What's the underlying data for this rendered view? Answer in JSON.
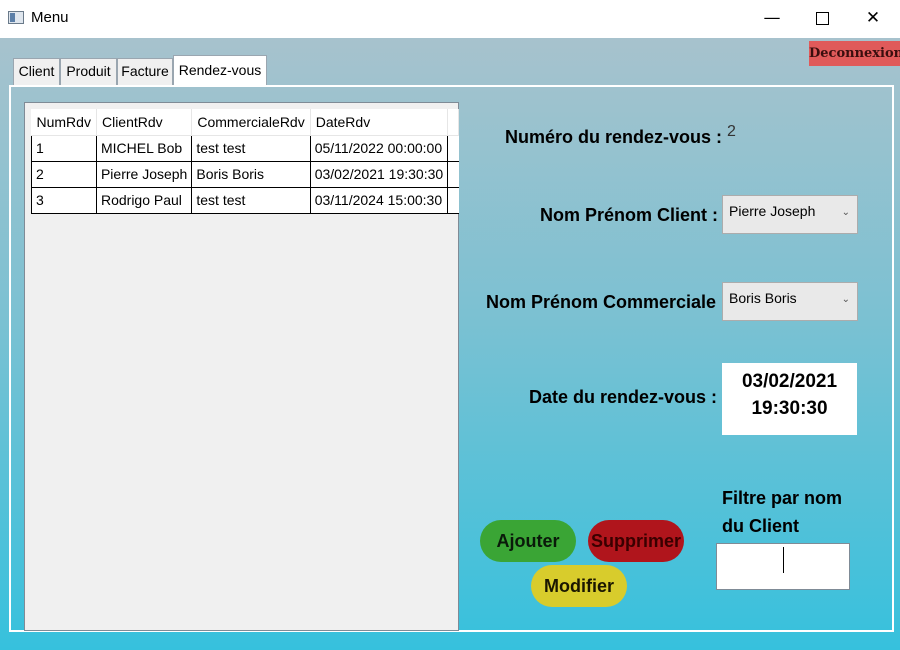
{
  "window": {
    "title": "Menu",
    "minimize_glyph": "—",
    "close_glyph": "✕"
  },
  "logout_label": "Deconnexion",
  "tabs": [
    {
      "label": "Client"
    },
    {
      "label": "Produit"
    },
    {
      "label": "Facture"
    },
    {
      "label": "Rendez-vous"
    }
  ],
  "grid": {
    "columns": [
      "NumRdv",
      "ClientRdv",
      "CommercialeRdv",
      "DateRdv"
    ],
    "rows": [
      [
        "1",
        "MICHEL Bob",
        "test test",
        "05/11/2022 00:00:00"
      ],
      [
        "2",
        "Pierre Joseph",
        "Boris Boris",
        "03/02/2021 19:30:30"
      ],
      [
        "3",
        "Rodrigo Paul",
        "test test",
        "03/11/2024 15:00:30"
      ]
    ]
  },
  "form": {
    "num_label": "Numéro du rendez-vous :",
    "num_value": "2",
    "client_label": "Nom Prénom Client :",
    "client_value": "Pierre Joseph",
    "commercial_label": "Nom Prénom Commerciale :",
    "commercial_value": "Boris Boris",
    "date_label": "Date du rendez-vous :",
    "date_value_line1": "03/02/2021",
    "date_value_line2": "19:30:30"
  },
  "buttons": {
    "add": "Ajouter",
    "delete": "Supprimer",
    "modify": "Modifier"
  },
  "filter": {
    "label_line1": "Filtre par nom",
    "label_line2": "du Client",
    "value": ""
  },
  "icons": {
    "dropdown": "chevron-down-icon",
    "app": "window-app-icon"
  }
}
